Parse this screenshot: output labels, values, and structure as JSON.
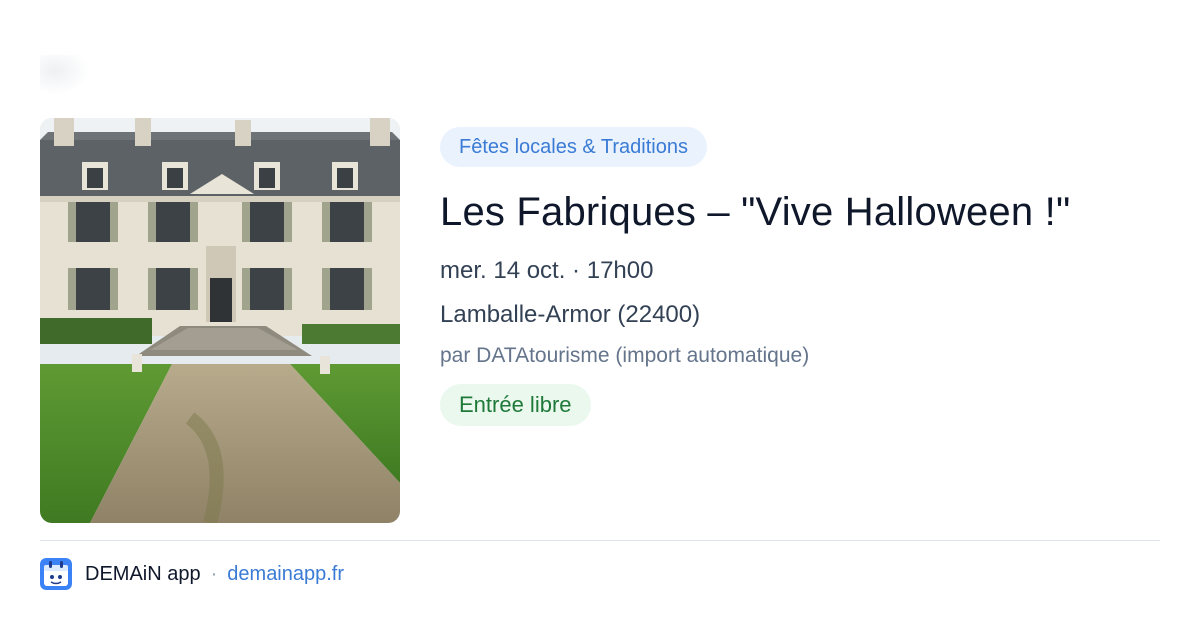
{
  "event": {
    "category": "Fêtes locales & Traditions",
    "title": "Les Fabriques – \"Vive Halloween !\"",
    "datetime": "mer. 14 oct. · 17h00",
    "location": "Lamballe-Armor (22400)",
    "organizer": "par DATAtourisme (import automatique)",
    "price": "Entrée libre"
  },
  "footer": {
    "app_name": "DEMAiN app",
    "separator": "·",
    "url": "demainapp.fr"
  },
  "colors": {
    "accent": "#3a7bd5",
    "category_bg": "#eaf2fd",
    "price_bg": "#eaf8ee",
    "price_text": "#1f7a3a",
    "title": "#0f172a",
    "muted": "#64748b"
  },
  "icons": {
    "app_logo": "demain-app-logo-icon"
  }
}
